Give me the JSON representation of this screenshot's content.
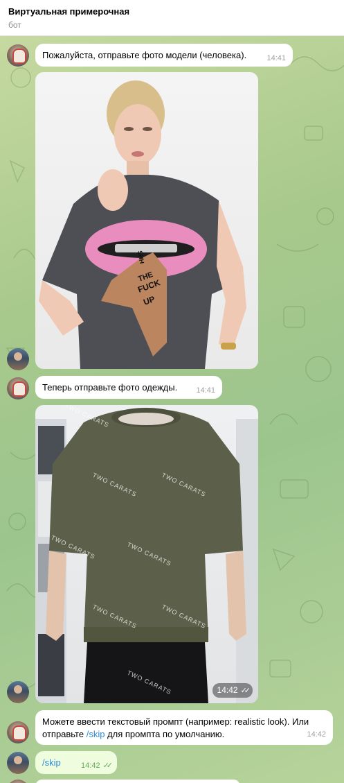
{
  "header": {
    "title": "Виртуальная примерочная",
    "subtitle": "бот"
  },
  "messages": {
    "m1": {
      "text": "Пожалуйста, отправьте фото модели (человека).",
      "time": "14:41"
    },
    "m2": {
      "time": ""
    },
    "m3": {
      "text": "Теперь отправьте фото одежды.",
      "time": "14:41"
    },
    "m4": {
      "time": "14:42",
      "watermark": "TWO CARATS"
    },
    "m5": {
      "text_before": "Можете ввести текстовый промпт (например: realistic look). Или отправьте ",
      "link": "/skip",
      "text_after": " для промпта по умолчанию.",
      "time": "14:42"
    },
    "m6": {
      "link": "/skip",
      "time": "14:42"
    }
  },
  "photo1_print": {
    "line1": "SHH",
    "line2": "THE",
    "line3": "FUCK",
    "line4": "UP"
  },
  "colors": {
    "background": "#a8c98c",
    "bubble_in": "#ffffff",
    "bubble_out": "#effdde",
    "link": "#2d8ad6",
    "check": "#5fa85a"
  },
  "icons": {
    "checks": "double-check-icon"
  }
}
